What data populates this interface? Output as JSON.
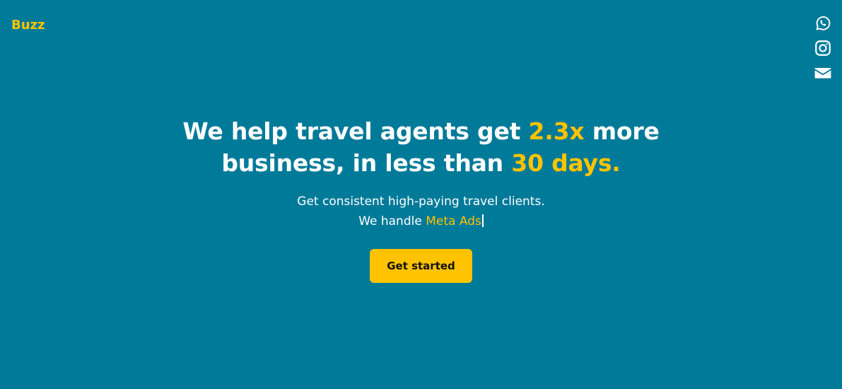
{
  "brand": {
    "name": "Buzz",
    "color": "#FFC300"
  },
  "theme": {
    "background": "#007A99",
    "accent": "#FFC300",
    "text": "#FFFFFF"
  },
  "social": {
    "items": [
      {
        "icon": "whatsapp-icon"
      },
      {
        "icon": "instagram-icon"
      },
      {
        "icon": "mail-icon"
      }
    ]
  },
  "hero": {
    "line1_part1": "We help travel agents get ",
    "line1_highlight": "2.3x",
    "line1_part2": " more",
    "line2_part1": "business, in less than ",
    "line2_highlight": "30 days.",
    "sub_line1": "Get consistent high-paying travel clients.",
    "sub_line2_prefix": "We handle ",
    "sub_line2_highlight": "Meta Ads",
    "cta_label": "Get started"
  }
}
